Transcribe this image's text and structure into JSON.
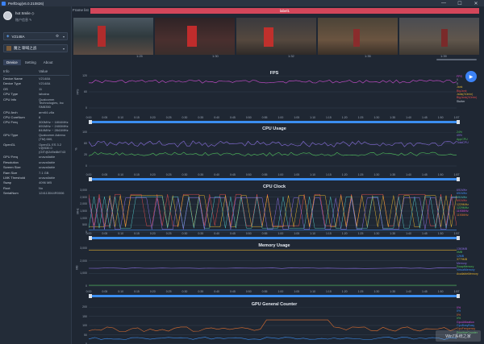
{
  "app": {
    "title": "PerfDog(v6.0.210826)"
  },
  "window": {
    "minimize": "—",
    "maximize": "☐",
    "close": "✕"
  },
  "user": {
    "name": "hot Smile ◇",
    "status": "账户信息 ✎"
  },
  "device_select": {
    "icon": "◈",
    "value": "V2148A",
    "gear": "⚙",
    "arrow": "▾"
  },
  "app_select": {
    "value": "魔之 聊域之战",
    "arrow": "▾"
  },
  "tabs": [
    "Device",
    "Setting",
    "About"
  ],
  "info": {
    "header_key": "Info",
    "header_value": "Value",
    "rows": [
      {
        "k": "Device Name",
        "v": "V2148A"
      },
      {
        "k": "Device Type",
        "v": "V2148A"
      },
      {
        "k": "OS",
        "v": "11"
      },
      {
        "k": "CPU Type",
        "v": "lahaina"
      },
      {
        "k": "CPU Info",
        "v": "Qualcomm\nTechnologies, Inc\nSM8350"
      },
      {
        "k": "CPU Arch",
        "v": "arm64-v8a"
      },
      {
        "k": "CPU CoreNum",
        "v": "8"
      },
      {
        "k": "CPU Freq",
        "v": "300MHz ~ 1804MHz\n691MHz ~ 2400MHz\n844MHz ~ 2841MHz"
      },
      {
        "k": "GPU Type",
        "v": "Qualcomm Adreno\n(TM) 660,"
      },
      {
        "k": "OpenGL",
        "v": "OpenGL ES 3.2\nV@530.0\n(GIT@2d9e8bf743"
      },
      {
        "k": "GPU Freq",
        "v": "unavailable"
      },
      {
        "k": "Resolution",
        "v": "unavailable"
      },
      {
        "k": "Screen Size",
        "v": "unavailable"
      },
      {
        "k": "Ram Size",
        "v": "7.1 GB"
      },
      {
        "k": "LMK Threshold",
        "v": "unavailable"
      },
      {
        "k": "Swap",
        "v": "4096 MB"
      },
      {
        "k": "Root",
        "v": "No"
      },
      {
        "k": "SerialNum",
        "v": "124113044R0006"
      }
    ]
  },
  "timeline": {
    "label": "Frame list",
    "bar_label": "label1",
    "times": [
      "1:25",
      "1:30",
      "1:32",
      "1:35",
      "1:39"
    ]
  },
  "charts": {
    "play_icon": "▶",
    "x_ticks": [
      "0:00",
      "0:05",
      "0:10",
      "0:15",
      "0:20",
      "0:25",
      "0:30",
      "0:35",
      "0:40",
      "0:45",
      "0:50",
      "0:55",
      "1:00",
      "1:05",
      "1:10",
      "1:15",
      "1:20",
      "1:25",
      "1:30",
      "1:35",
      "1:40",
      "1:45",
      "1:50",
      "1:57"
    ],
    "fps": {
      "title": "FPS",
      "y_axis": "FPS",
      "y_ticks": [
        "120",
        "60",
        "0"
      ],
      "legend": [
        {
          "label": "FPS",
          "color": "#d14fd6"
        },
        {
          "label": "0",
          "color": "#9aa5b4"
        },
        {
          "label": "0",
          "color": "#9aa5b4"
        },
        {
          "label": "Jank",
          "color": "#e0b030"
        },
        {
          "label": "BigJank",
          "color": "#e04b4b"
        },
        {
          "label": "Jank(/10min)",
          "color": "#e0b030"
        },
        {
          "label": "BigJank(/10min)",
          "color": "#e04b4b"
        },
        {
          "label": "Stutter",
          "color": "#c0c8d4"
        }
      ]
    },
    "cpu_usage": {
      "title": "CPU Usage",
      "y_axis": "%",
      "y_ticks": [
        "100",
        "60",
        "20",
        "0"
      ],
      "legend": [
        {
          "label": "24%",
          "color": "#4fc05a"
        },
        {
          "label": "49%",
          "color": "#8a6fe0"
        },
        {
          "label": "AppCPU",
          "color": "#4fc05a"
        },
        {
          "label": "TotalCPU",
          "color": "#8a6fe0"
        }
      ]
    },
    "cpu_clock": {
      "title": "CPU Clock",
      "y_axis": "MHz",
      "y_ticks": [
        "3,000",
        "2,500",
        "2,000",
        "1,500",
        "1,000",
        "500",
        "0"
      ],
      "legend": [
        {
          "label": "691MHz",
          "color": "#8a6fe0"
        },
        {
          "label": "691MHz",
          "color": "#3b8ef0"
        },
        {
          "label": "691MHz",
          "color": "#4fc0c0"
        },
        {
          "label": "691MHz",
          "color": "#e04b4b"
        },
        {
          "label": "1229MHz",
          "color": "#e0b030"
        },
        {
          "label": "1229MHz",
          "color": "#4fc05a"
        },
        {
          "label": "1190MHz",
          "color": "#d14fd6"
        },
        {
          "label": "1190MHz",
          "color": "#e07030"
        }
      ]
    },
    "memory": {
      "title": "Memory Usage",
      "y_axis": "MB",
      "y_ticks": [
        "3,000",
        "2,000",
        "1,000",
        "0"
      ],
      "legend": [
        {
          "label": "1363MB",
          "color": "#8a6fe0"
        },
        {
          "label": "0MB",
          "color": "#4fc05a"
        },
        {
          "label": "12MB",
          "color": "#3b8ef0"
        },
        {
          "label": "3779MB",
          "color": "#e0b030"
        },
        {
          "label": "Memory",
          "color": "#8a6fe0"
        },
        {
          "label": "SwapMemory",
          "color": "#4fc05a"
        },
        {
          "label": "VirtualMemory",
          "color": "#3b8ef0"
        },
        {
          "label": "AvailableMemory",
          "color": "#e0b030"
        }
      ]
    },
    "gpu_counter": {
      "title": "GPU General Counter",
      "y_ticks": [
        "200",
        "150",
        "100",
        "50",
        "0"
      ],
      "legend": [
        {
          "label": "0%",
          "color": "#d14fd6"
        },
        {
          "label": "0%",
          "color": "#3b8ef0"
        },
        {
          "label": "0%",
          "color": "#e07030"
        },
        {
          "label": "0%",
          "color": "#4fc05a"
        },
        {
          "label": "GpuUtilization",
          "color": "#d14fd6"
        },
        {
          "label": "GpuBusyBusy",
          "color": "#3b8ef0"
        },
        {
          "label": "GpuFrequency",
          "color": "#e07030"
        },
        {
          "label": "PrimitiveCounter",
          "color": "#4fc05a"
        }
      ]
    }
  },
  "watermark": "Win7系统之家"
}
